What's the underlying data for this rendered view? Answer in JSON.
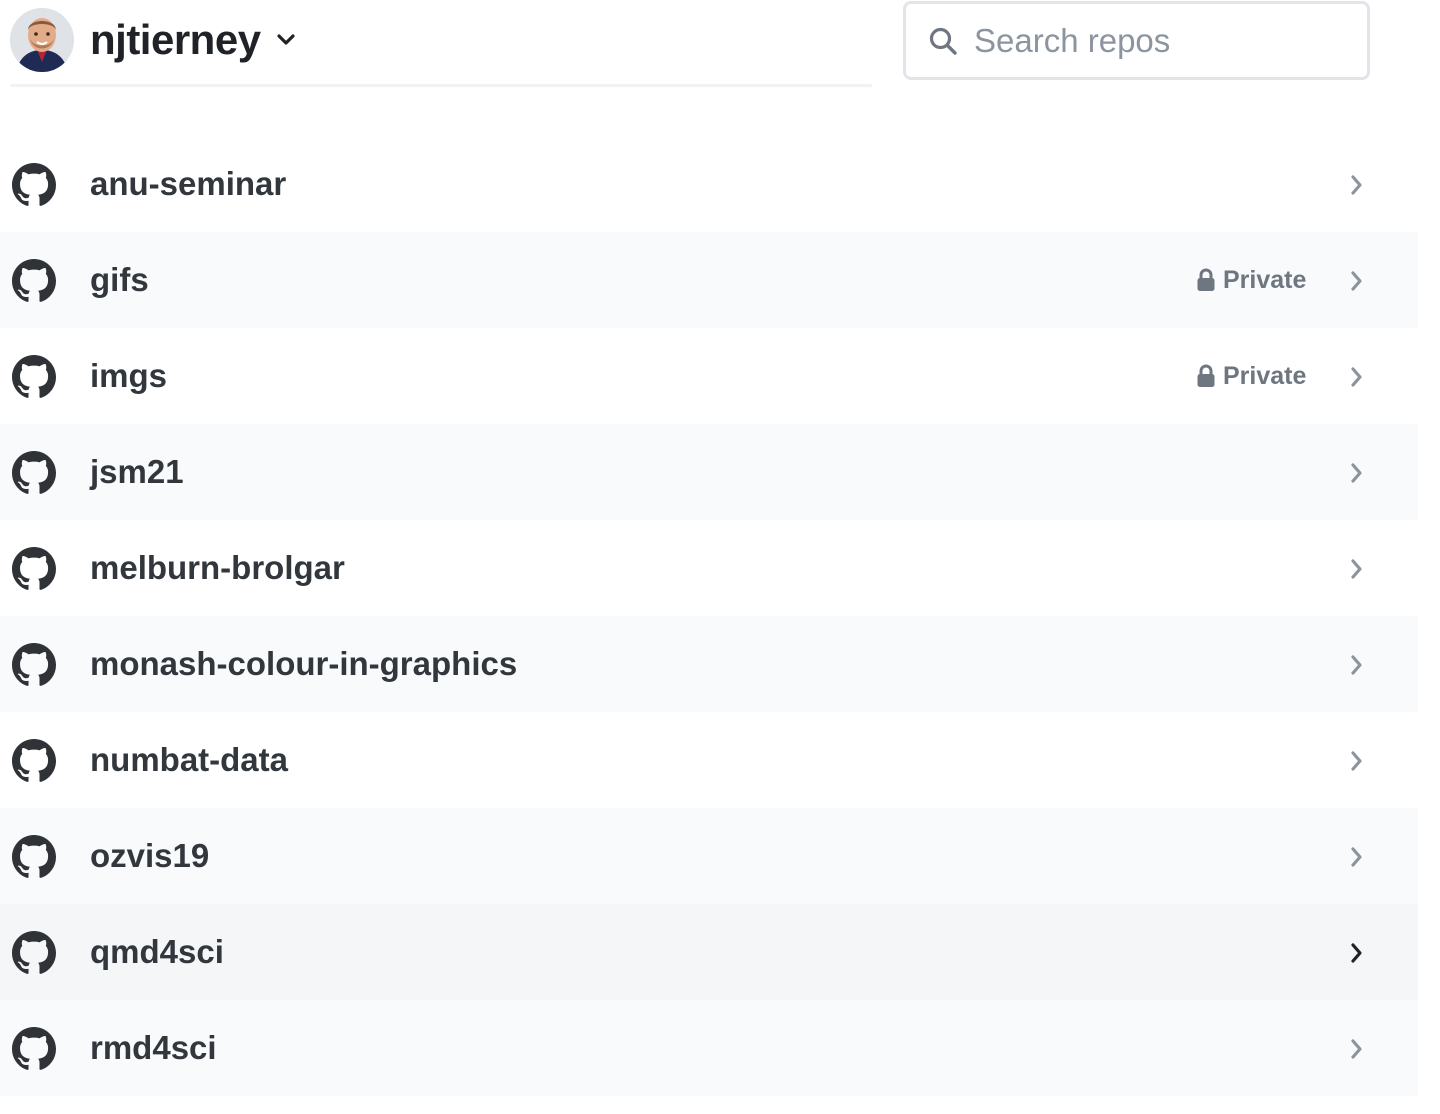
{
  "header": {
    "username": "njtierney",
    "search_placeholder": "Search repos"
  },
  "icons": {
    "avatar": "avatar",
    "caret": "chevron-down-icon",
    "search": "search-icon",
    "repo": "github-icon",
    "lock": "lock-icon",
    "row_arrow": "chevron-right-icon"
  },
  "repos": [
    {
      "name": "anu-seminar",
      "badge": ""
    },
    {
      "name": "gifs",
      "badge": "Private"
    },
    {
      "name": "imgs",
      "badge": "Private"
    },
    {
      "name": "jsm21",
      "badge": ""
    },
    {
      "name": "melburn-brolgar",
      "badge": ""
    },
    {
      "name": "monash-colour-in-graphics",
      "badge": ""
    },
    {
      "name": "numbat-data",
      "badge": ""
    },
    {
      "name": "ozvis19",
      "badge": ""
    },
    {
      "name": "qmd4sci",
      "badge": "",
      "hovered": true
    },
    {
      "name": "rmd4sci",
      "badge": ""
    }
  ],
  "colors": {
    "text": "#32373d",
    "muted": "#6e7781",
    "chevron": "#8c959f",
    "chevron_active": "#1f2328",
    "row_alt": "#f9fafb"
  }
}
